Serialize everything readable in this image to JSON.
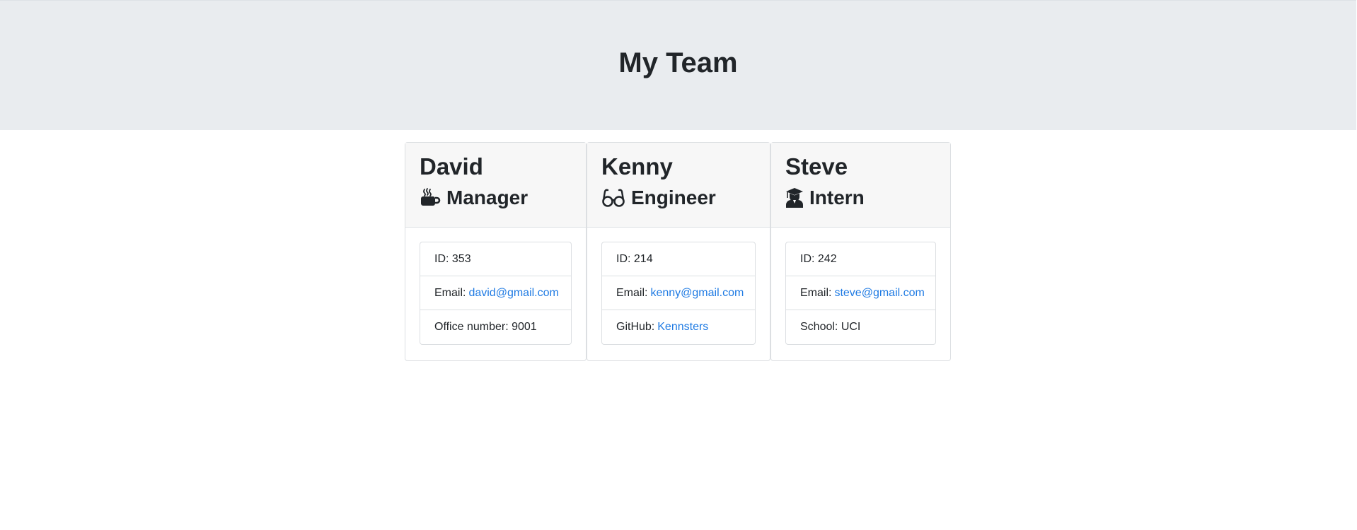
{
  "header": {
    "title": "My Team"
  },
  "team": [
    {
      "name": "David",
      "role": "Manager",
      "role_icon": "coffee-icon",
      "id_label": "ID: 353",
      "email_label": "Email:",
      "email": "david@gmail.com",
      "extra_label": "Office number: 9001",
      "extra_link": ""
    },
    {
      "name": "Kenny",
      "role": "Engineer",
      "role_icon": "glasses-icon",
      "id_label": "ID: 214",
      "email_label": "Email:",
      "email": "kenny@gmail.com",
      "extra_label": "GitHub:",
      "extra_link": "Kennsters"
    },
    {
      "name": "Steve",
      "role": "Intern",
      "role_icon": "graduate-icon",
      "id_label": "ID: 242",
      "email_label": "Email:",
      "email": "steve@gmail.com",
      "extra_label": "School: UCI",
      "extra_link": ""
    }
  ],
  "colors": {
    "header_bg": "#e9ecef",
    "link": "#1e7ae3",
    "text": "#212529"
  }
}
